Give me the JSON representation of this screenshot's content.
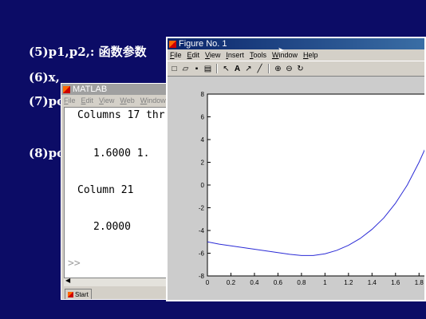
{
  "slide": {
    "lines": [
      "(5)p1,p2,: 函数参数",
      "(6)x,",
      "(7)po",
      "(8)po"
    ]
  },
  "matlab": {
    "title": "MATLAB",
    "menu": [
      "File",
      "Edit",
      "View",
      "Web",
      "Window"
    ],
    "console": {
      "line1": "Columns 17 thr",
      "line2": "1.6000    1.",
      "line3": "Column 21",
      "line4": "2.0000",
      "prompt": ">>"
    },
    "start_label": "Start"
  },
  "figure": {
    "title": "Figure No. 1",
    "menu": [
      "File",
      "Edit",
      "View",
      "Insert",
      "Tools",
      "Window",
      "Help"
    ],
    "toolbar_icons": [
      "new-icon",
      "open-icon",
      "save-icon",
      "print-icon",
      "arrow-icon",
      "text-icon",
      "line-arrow-icon",
      "line-icon",
      "zoom-in-icon",
      "zoom-out-icon",
      "rotate-icon"
    ]
  },
  "chart_data": {
    "type": "line",
    "title": "",
    "xlabel": "",
    "ylabel": "",
    "xlim": [
      0,
      1.9
    ],
    "ylim": [
      -8,
      8
    ],
    "xticks": [
      0,
      0.2,
      0.4,
      0.6,
      0.8,
      1,
      1.2,
      1.4,
      1.6,
      1.8
    ],
    "yticks": [
      -8,
      -6,
      -4,
      -2,
      0,
      2,
      4,
      6,
      8
    ],
    "grid": false,
    "colors": {
      "line": "#2b2bd6"
    },
    "series": [
      {
        "x": [
          0,
          0.1,
          0.2,
          0.3,
          0.4,
          0.5,
          0.6,
          0.7,
          0.8,
          0.9,
          1.0,
          1.1,
          1.2,
          1.3,
          1.4,
          1.5,
          1.6,
          1.7,
          1.8,
          1.9
        ],
        "y": [
          -5.0,
          -5.2,
          -5.35,
          -5.5,
          -5.65,
          -5.8,
          -5.95,
          -6.1,
          -6.2,
          -6.2,
          -6.05,
          -5.75,
          -5.3,
          -4.7,
          -3.9,
          -2.9,
          -1.6,
          0.0,
          2.0,
          4.3
        ]
      }
    ]
  }
}
